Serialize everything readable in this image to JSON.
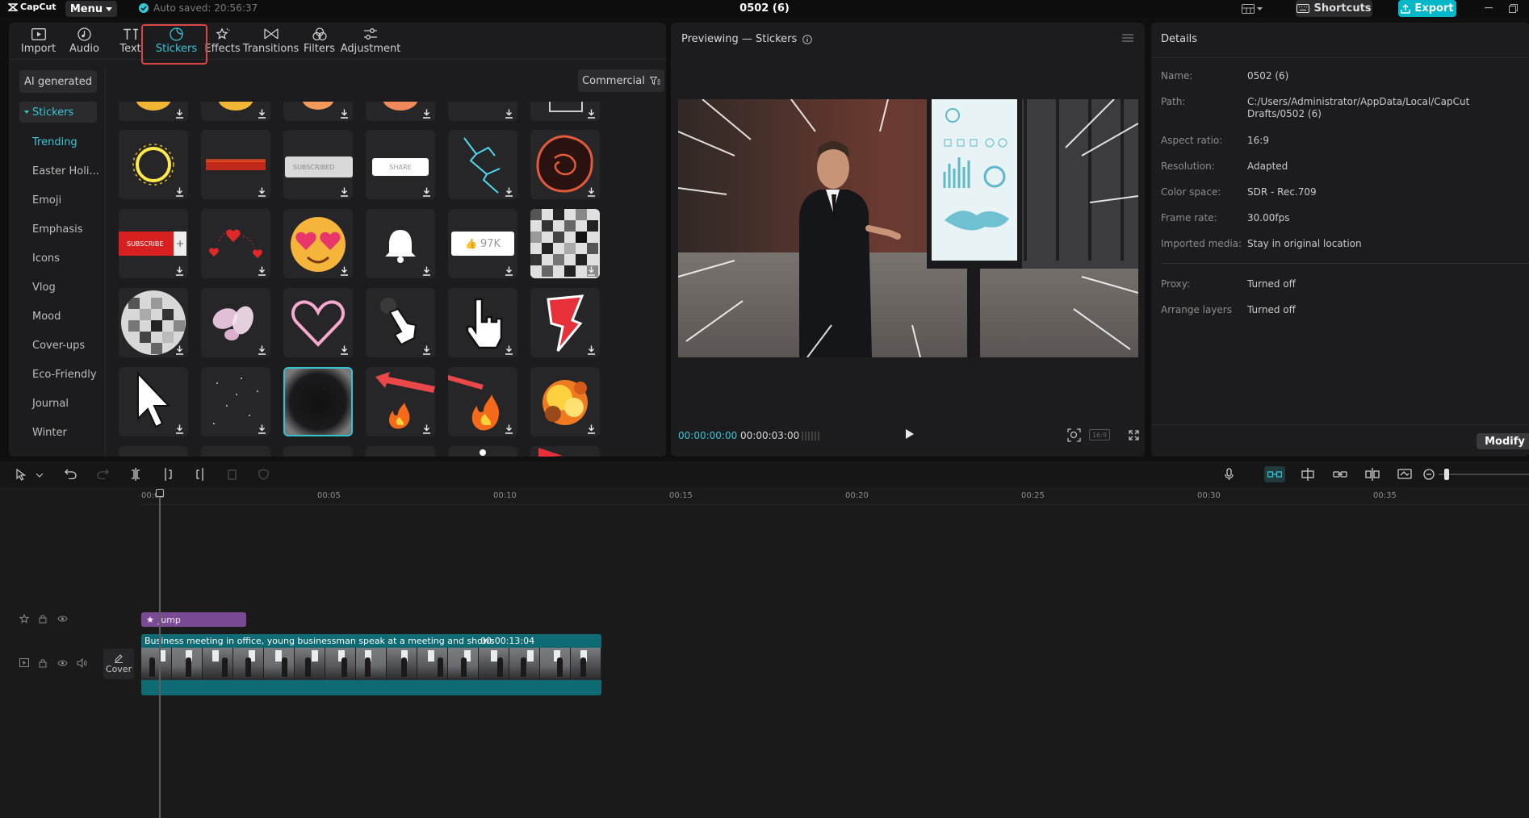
{
  "app": {
    "name": "CapCut",
    "menu_label": "Menu",
    "autosave": "Auto saved: 20:56:37",
    "project_title": "0502 (6)",
    "shortcuts_label": "Shortcuts",
    "export_label": "Export"
  },
  "toolbar": {
    "tabs": [
      {
        "label": "Import",
        "icon": "import-icon"
      },
      {
        "label": "Audio",
        "icon": "audio-icon"
      },
      {
        "label": "Text",
        "icon": "text-icon"
      },
      {
        "label": "Stickers",
        "icon": "stickers-icon",
        "active": true
      },
      {
        "label": "Effects",
        "icon": "effects-icon"
      },
      {
        "label": "Transitions",
        "icon": "transitions-icon"
      },
      {
        "label": "Filters",
        "icon": "filters-icon"
      },
      {
        "label": "Adjustment",
        "icon": "adjustment-icon"
      }
    ]
  },
  "sidebar": {
    "ai_generated": "AI generated",
    "section": "Stickers",
    "items": [
      "Trending",
      "Easter Holi...",
      "Emoji",
      "Emphasis",
      "Icons",
      "Vlog",
      "Mood",
      "Cover-ups",
      "Eco-Friendly",
      "Journal",
      "Winter"
    ],
    "active_item": "Trending"
  },
  "filter": {
    "label": "Commercial"
  },
  "stickers": {
    "row2": [
      "glowing-ring",
      "fire-text",
      "SUBSCRIBED",
      "SHARE",
      "lightning",
      "explosion-outline"
    ],
    "row3": [
      "SUBSCRIBE",
      "hearts",
      "heart-eyes-emoji",
      "bell",
      "97K",
      "pixel-mosaic"
    ],
    "row4": [
      "pixel-ball",
      "butterfly",
      "neon-heart",
      "pointer-hand",
      "click-hand",
      "red-arrow"
    ],
    "row5": [
      "pixel-cursor",
      "sparkle-dust",
      "speed-lines",
      "red-arrow-fire",
      "fire",
      "fire-explosion"
    ],
    "subscribed_text": "SUBSCRIBED",
    "share_text": "SHARE",
    "subscribe_text": "SUBSCRIBE",
    "like_count": "97K"
  },
  "preview": {
    "title": "Previewing — Stickers",
    "time_current": "00:00:00:00",
    "time_total": "00:00:03:00",
    "ratio_label": "16:9"
  },
  "details": {
    "title": "Details",
    "rows": [
      {
        "label": "Name:",
        "value": "0502 (6)"
      },
      {
        "label": "Path:",
        "value": "C:/Users/Administrator/AppData/Local/CapCut Drafts/0502 (6)"
      },
      {
        "label": "Aspect ratio:",
        "value": "16:9"
      },
      {
        "label": "Resolution:",
        "value": "Adapted"
      },
      {
        "label": "Color space:",
        "value": "SDR - Rec.709"
      },
      {
        "label": "Frame rate:",
        "value": "30.00fps"
      },
      {
        "label": "Imported media:",
        "value": "Stay in original location"
      }
    ],
    "rows2": [
      {
        "label": "Proxy:",
        "value": "Turned off"
      },
      {
        "label": "Arrange layers",
        "value": "Turned off"
      }
    ],
    "modify_label": "Modify"
  },
  "timeline": {
    "ticks": [
      "00:00",
      "00:05",
      "00:10",
      "00:15",
      "00:20",
      "00:25",
      "00:30",
      "00:35"
    ],
    "sticker_clip": "Jump",
    "video_clip_name": "Business meeting in office, young businessman speak at a meeting and shows",
    "video_clip_duration": "00:00:13:04",
    "cover_label": "Cover"
  }
}
